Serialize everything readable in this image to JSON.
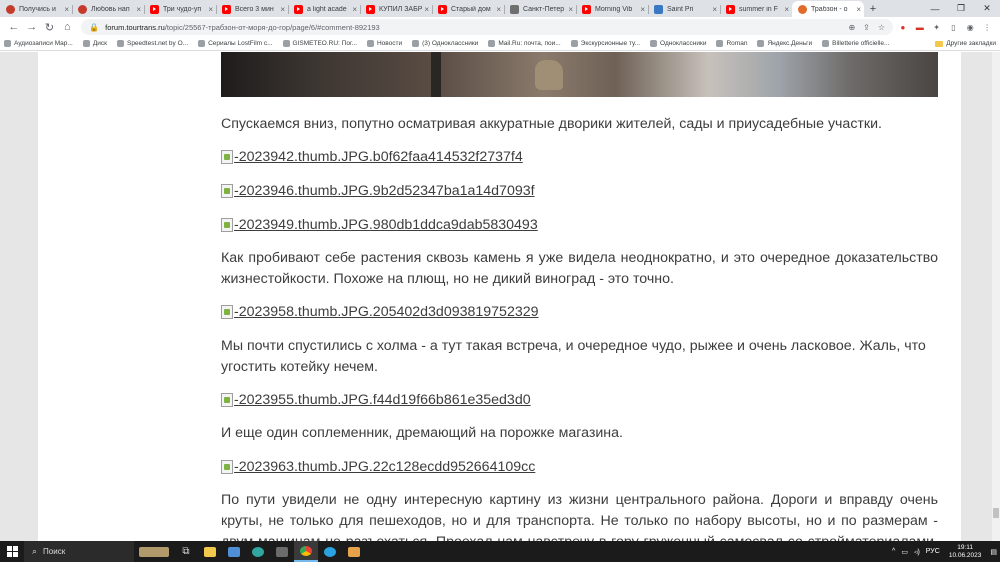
{
  "browser": {
    "tabs": [
      {
        "title": "Получись и",
        "icon": "ok"
      },
      {
        "title": "Любовь нап",
        "icon": "ok"
      },
      {
        "title": "Три чудо-уп",
        "icon": "yt"
      },
      {
        "title": "Всего 3 мин",
        "icon": "yt"
      },
      {
        "title": "a light acade",
        "icon": "yt"
      },
      {
        "title": "КУПИЛ ЗАБР",
        "icon": "yt"
      },
      {
        "title": "Старый дом",
        "icon": "yt"
      },
      {
        "title": "Санкт-Петер",
        "icon": "sp"
      },
      {
        "title": "Morning Vib",
        "icon": "yt"
      },
      {
        "title": "Saint Pri",
        "icon": "sp2"
      },
      {
        "title": "summer in F",
        "icon": "yt"
      },
      {
        "title": "Трабзон - о",
        "icon": "sun",
        "active": true
      }
    ],
    "new_tab": "+",
    "url_host": "forum.tourtrans.ru",
    "url_path": "/topic/25567-трабзон-от-моря-до-гор/page/6/#comment-892193",
    "bookmarks": [
      "Аудиозаписи Мар...",
      "Диск",
      "Speedtest.net by O...",
      "Сериалы LostFilm с...",
      "GISMETEO.RU: Пог...",
      "Новости",
      "(3) Одноклассники",
      "Mail.Ru: почта, пои...",
      "Экскурсионные ту...",
      "Одноклассники",
      "Roman",
      "Яндекс.Деньги",
      "Billetterie officielle..."
    ],
    "other_bookmarks": "Другие закладки"
  },
  "article": {
    "p1": "Спускаемся вниз, попутно осматривая аккуратные дворики жителей, сады и приусадебные участки.",
    "img1": "-2023942.thumb.JPG.b0f62faa414532f2737f4",
    "img2": "-2023946.thumb.JPG.9b2d52347ba1a14d7093f",
    "img3": "-2023949.thumb.JPG.980db1ddca9dab5830493",
    "p2": "Как пробивают себе растения сквозь камень я уже  видела неоднократно, и это очередное доказательство жизнестойкости. Похоже на плющ, но не дикий виноград - это точно.",
    "img4": "-2023958.thumb.JPG.205402d3d093819752329",
    "p3": "Мы почти спустились с холма - а тут такая встреча, и очередное чудо, рыжее и очень ласковое. Жаль, что угостить котейку нечем.",
    "img5": "-2023955.thumb.JPG.f44d19f66b861e35ed3d0",
    "p4": "И еще один соплеменник, дремающий на порожке магазина.",
    "img6": "-2023963.thumb.JPG.22c128ecdd952664109cc",
    "p5": "По пути увидели не одну интересную картину из жизни центрального района. Дороги и вправду очень круты, не только для пешеходов, но и для транспорта. Не только по набору высоты, но и по размерам - двум машинам не разъехаться. Проехал нам навстречу в гору груженный самосвал со стройматериалами, сдал назад и стал"
  },
  "taskbar": {
    "search_label": "Поиск",
    "lang": "РУС",
    "time": "19:11",
    "date": "10.06.2023"
  }
}
